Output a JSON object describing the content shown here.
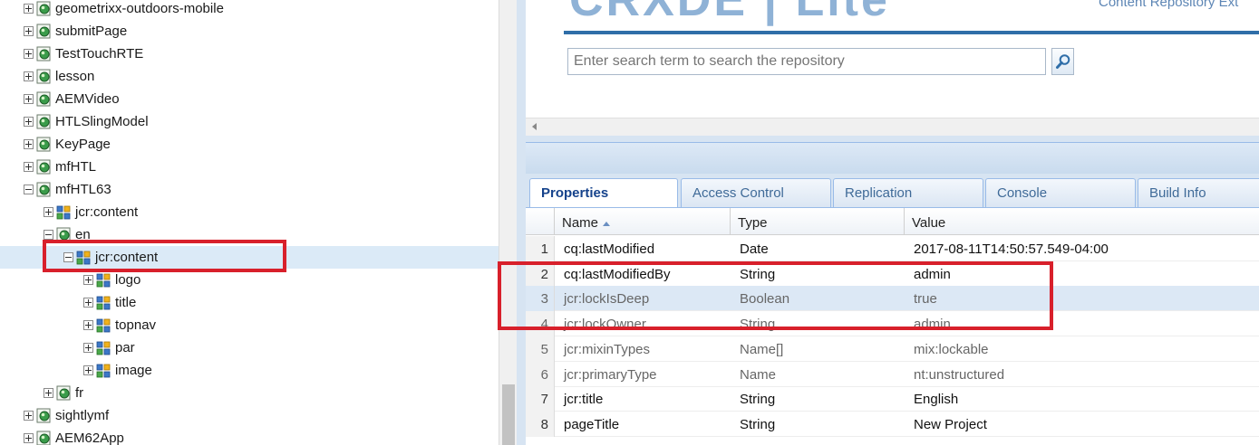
{
  "tree": {
    "nodes": [
      {
        "label": "geometrixx-outdoors-mobile",
        "kind": "page",
        "expander": "plus"
      },
      {
        "label": "submitPage",
        "kind": "page",
        "expander": "plus"
      },
      {
        "label": "TestTouchRTE",
        "kind": "page",
        "expander": "plus"
      },
      {
        "label": "lesson",
        "kind": "page",
        "expander": "plus"
      },
      {
        "label": "AEMVideo",
        "kind": "page",
        "expander": "plus"
      },
      {
        "label": "HTLSlingModel",
        "kind": "page",
        "expander": "plus"
      },
      {
        "label": "KeyPage",
        "kind": "page",
        "expander": "plus"
      },
      {
        "label": "mfHTL",
        "kind": "page",
        "expander": "plus"
      },
      {
        "label": "mfHTL63",
        "kind": "page",
        "expander": "minus"
      },
      {
        "label": "jcr:content",
        "kind": "component",
        "expander": "plus"
      },
      {
        "label": "en",
        "kind": "page",
        "expander": "minus"
      },
      {
        "label": "jcr:content",
        "kind": "component",
        "expander": "minus",
        "selected": true
      },
      {
        "label": "logo",
        "kind": "component",
        "expander": "plus"
      },
      {
        "label": "title",
        "kind": "component",
        "expander": "plus"
      },
      {
        "label": "topnav",
        "kind": "component",
        "expander": "plus"
      },
      {
        "label": "par",
        "kind": "component",
        "expander": "plus"
      },
      {
        "label": "image",
        "kind": "component",
        "expander": "plus"
      },
      {
        "label": "fr",
        "kind": "page",
        "expander": "plus"
      },
      {
        "label": "sightlymf",
        "kind": "page",
        "expander": "plus"
      },
      {
        "label": "AEM62App",
        "kind": "page",
        "expander": "plus"
      }
    ]
  },
  "header": {
    "logo_text": "CRXDE | Lite",
    "logo_subtitle": "Content Repository Ext",
    "search_placeholder": "Enter search term to search the repository",
    "search_icon": "magnifier-icon"
  },
  "tabs": [
    {
      "label": "Properties",
      "active": true
    },
    {
      "label": "Access Control",
      "active": false
    },
    {
      "label": "Replication",
      "active": false
    },
    {
      "label": "Console",
      "active": false
    },
    {
      "label": "Build Info",
      "active": false
    }
  ],
  "grid": {
    "columns": [
      "Name",
      "Type",
      "Value"
    ],
    "rows": [
      {
        "n": "1",
        "name": "cq:lastModified",
        "type": "Date",
        "value": "2017-08-11T14:50:57.549-04:00",
        "dim": false
      },
      {
        "n": "2",
        "name": "cq:lastModifiedBy",
        "type": "String",
        "value": "admin",
        "dim": false
      },
      {
        "n": "3",
        "name": "jcr:lockIsDeep",
        "type": "Boolean",
        "value": "true",
        "dim": true,
        "selected": true
      },
      {
        "n": "4",
        "name": "jcr:lockOwner",
        "type": "String",
        "value": "admin",
        "dim": true
      },
      {
        "n": "5",
        "name": "jcr:mixinTypes",
        "type": "Name[]",
        "value": "mix:lockable",
        "dim": true
      },
      {
        "n": "6",
        "name": "jcr:primaryType",
        "type": "Name",
        "value": "nt:unstructured",
        "dim": true
      },
      {
        "n": "7",
        "name": "jcr:title",
        "type": "String",
        "value": "English",
        "dim": false
      },
      {
        "n": "8",
        "name": "pageTitle",
        "type": "String",
        "value": "New Project",
        "dim": false
      }
    ]
  },
  "colors": {
    "annotation": "#d8202b",
    "accent": "#2f6ea8",
    "selection": "#dbeaf7"
  }
}
